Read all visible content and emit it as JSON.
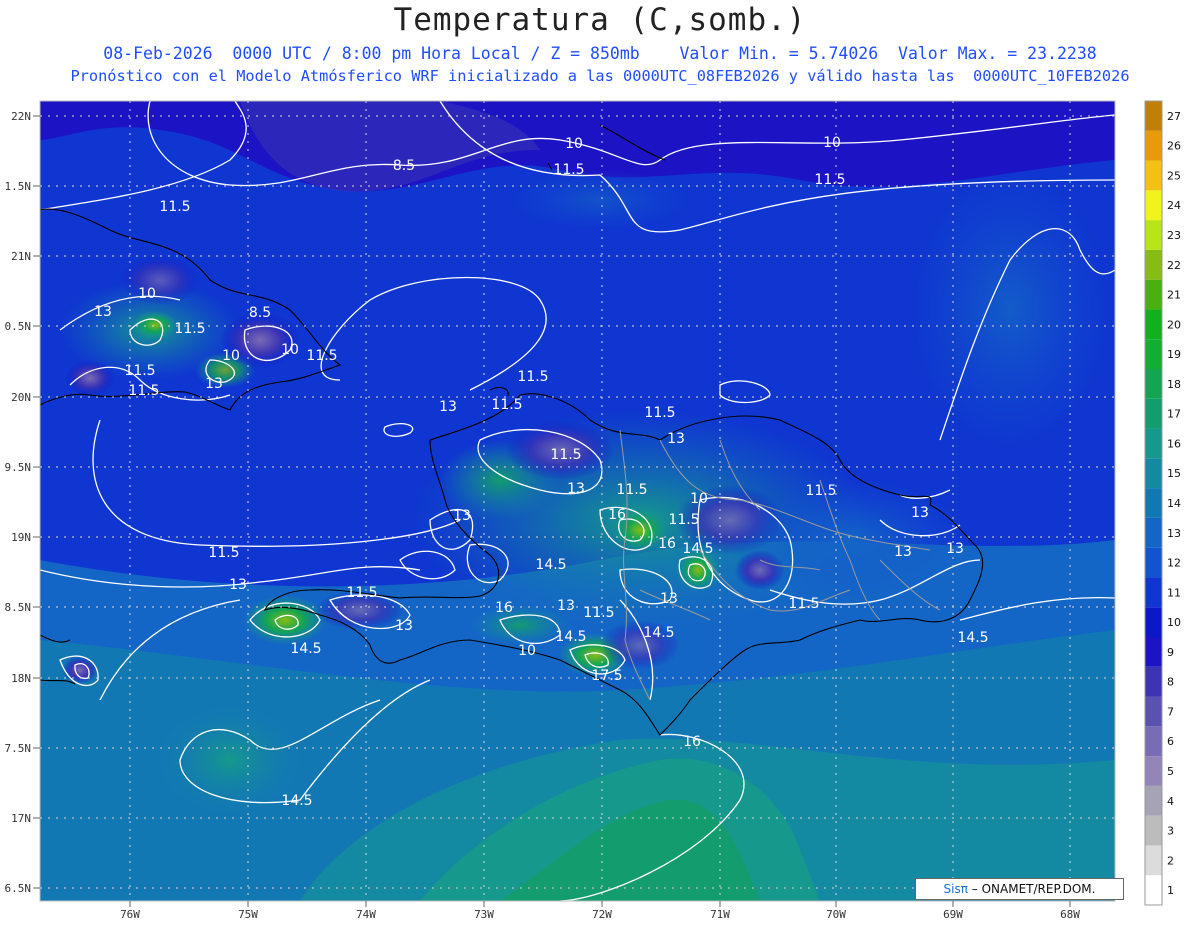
{
  "title": "Temperatura (C,somb.)",
  "subtitle1": "08-Feb-2026  0000 UTC / 8:00 pm Hora Local / Z = 850mb    Valor Min. = 5.74026  Valor Max. = 23.2238",
  "subtitle2": "Pronóstico con el Modelo Atmósferico WRF inicializado a las 0000UTC_08FEB2026 y válido hasta las  0000UTC_10FEB2026",
  "lat_labels": [
    "22N",
    "1.5N",
    "21N",
    "0.5N",
    "20N",
    "9.5N",
    "19N",
    "8.5N",
    "18N",
    "7.5N",
    "17N",
    "6.5N"
  ],
  "lon_labels": [
    "76W",
    "75W",
    "74W",
    "73W",
    "72W",
    "71W",
    "70W",
    "69W",
    "68W"
  ],
  "colorbar": {
    "levels": [
      "1",
      "2",
      "3",
      "4",
      "5",
      "6",
      "7",
      "8",
      "9",
      "10",
      "11",
      "12",
      "13",
      "14",
      "15",
      "16",
      "17",
      "18",
      "19",
      "20",
      "21",
      "22",
      "23",
      "24",
      "25",
      "26",
      "27"
    ],
    "colors": [
      "#ffffff",
      "#dcdcdc",
      "#bcbcbc",
      "#a4a4b4",
      "#9484b8",
      "#7a6cb4",
      "#5a52b0",
      "#3c34b4",
      "#1c14c4",
      "#0a18c8",
      "#0f36d0",
      "#1254d0",
      "#1466c6",
      "#1278b4",
      "#148aa2",
      "#16998c",
      "#139c6e",
      "#14a454",
      "#12ae32",
      "#12b01e",
      "#4ab012",
      "#86bc14",
      "#b8e41a",
      "#f0f41c",
      "#f4c014",
      "#e89a08",
      "#c08008"
    ]
  },
  "contour_labels": [
    "8.5",
    "10",
    "10",
    "11.5",
    "11.5",
    "11.5",
    "10",
    "13",
    "11.5",
    "8.5",
    "10",
    "11.5",
    "11.5",
    "13",
    "11.5",
    "11.5",
    "13",
    "10",
    "11.5",
    "13",
    "11.5",
    "13",
    "13",
    "11.5",
    "16",
    "14.5",
    "11.5",
    "10",
    "11.5",
    "13",
    "13",
    "13",
    "11.5",
    "16",
    "14.5",
    "13",
    "11.5",
    "14.5",
    "10",
    "17.5",
    "11.5",
    "14.5",
    "14.5",
    "16",
    "13",
    "13",
    "14.5",
    "11.5",
    "11.5",
    "13",
    "16",
    "14.5"
  ],
  "credit": {
    "brand": "Sisπ",
    "text": "– ONAMET/REP.DOM."
  }
}
